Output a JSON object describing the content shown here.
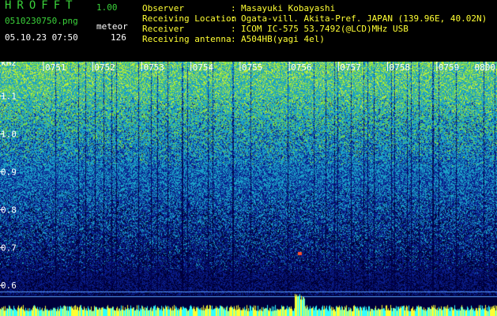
{
  "app": {
    "title": "HROFFT",
    "version": "1.00"
  },
  "file": {
    "name": "0510230750.png",
    "datetime": "05.10.23 07:50"
  },
  "meteor": {
    "label": "meteor",
    "count": "126"
  },
  "station": [
    {
      "label": "Observer",
      "value": "Masayuki Kobayashi"
    },
    {
      "label": "Receiving Location",
      "value": "Ogata-vill. Akita-Pref. JAPAN (139.96E, 40.02N)"
    },
    {
      "label": "Receiver",
      "value": "ICOM IC-575 53.7492(@LCD)MHz USB"
    },
    {
      "label": "Receiving antenna",
      "value": "A504HB(yagi 4el)"
    }
  ],
  "axes": {
    "y_unit": "kHz",
    "y_ticks": [
      {
        "value": 1.1,
        "label": "1.1"
      },
      {
        "value": 1.0,
        "label": "1.0"
      },
      {
        "value": 0.9,
        "label": "0.9"
      },
      {
        "value": 0.8,
        "label": "0.8"
      },
      {
        "value": 0.7,
        "label": "0.7"
      },
      {
        "value": 0.6,
        "label": "0.6"
      }
    ],
    "y_range": [
      0.565,
      1.17
    ],
    "time_ticks": [
      "0751",
      "0752",
      "0753",
      "0754",
      "0755",
      "0756",
      "0757",
      "0758",
      "0759",
      "0800"
    ]
  },
  "colors": {
    "label_green": "#3ad23a",
    "label_white": "#ffffff",
    "tick_yellow": "#ffff33",
    "noise_low": "#0a1e8c",
    "noise_mid": "#1aa0c8",
    "noise_high": "#7ee03c"
  }
}
